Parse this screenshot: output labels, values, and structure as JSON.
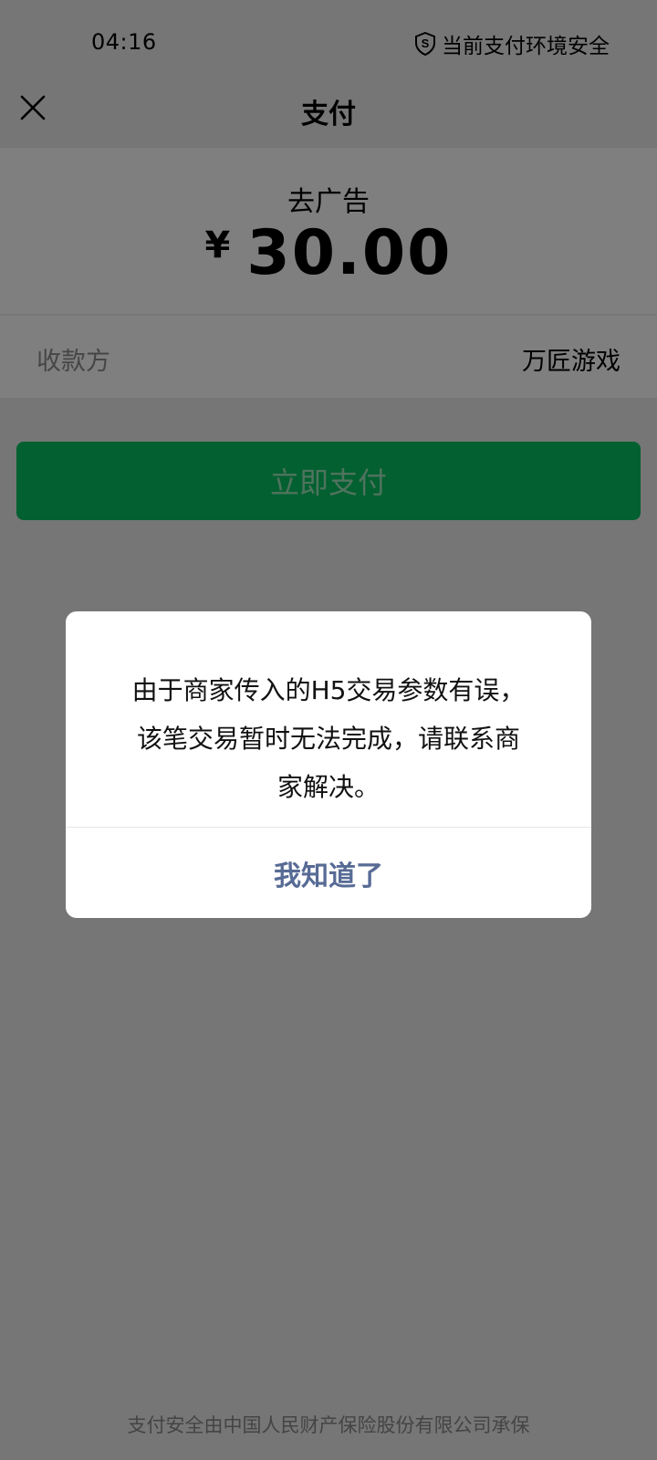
{
  "status_bar": {
    "time": "04:16",
    "security_text": "当前支付环境安全",
    "security_icon": "shield-icon"
  },
  "nav": {
    "title": "支付",
    "close_icon": "close-icon"
  },
  "order": {
    "product_name": "去广告",
    "currency_symbol": "¥",
    "amount": "30.00"
  },
  "payee": {
    "label": "收款方",
    "value": "万匠游戏"
  },
  "pay_button": {
    "label": "立即支付",
    "color": "#07c160"
  },
  "dialog": {
    "message_lines": [
      "由于商家传入的H5交易参数有误，",
      "该笔交易暂时无法完成，请联系商",
      "家解决。"
    ],
    "confirm_label": "我知道了",
    "confirm_color": "#576b95"
  },
  "footer": {
    "note": "支付安全由中国人民财产保险股份有限公司承保"
  }
}
